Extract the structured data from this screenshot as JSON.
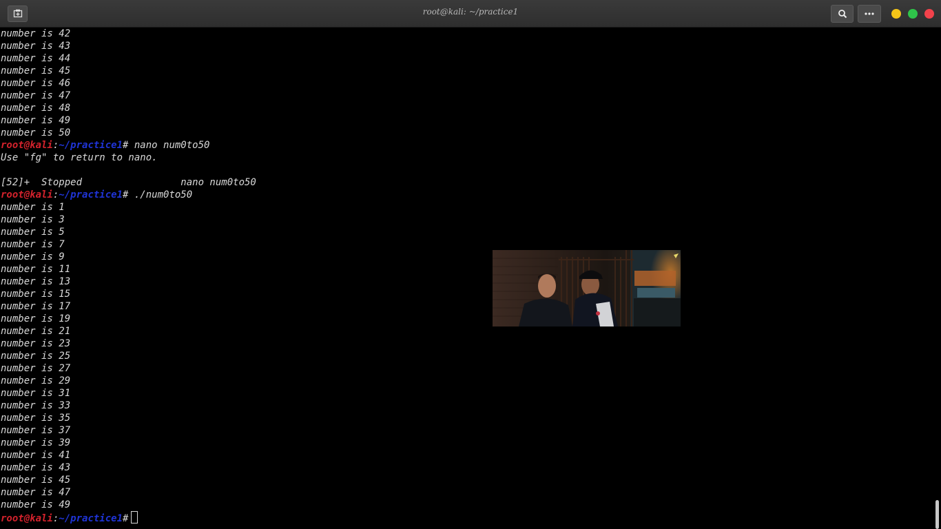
{
  "window": {
    "title": "root@kali: ~/practice1",
    "new_tab_icon": "new-tab-icon",
    "search_icon": "search-icon",
    "menu_icon": "ellipsis-icon",
    "controls": {
      "minimize": "#f5c518",
      "maximize": "#2fc44a",
      "close": "#f2424b"
    }
  },
  "terminal": {
    "prompt": {
      "user_host": "root@kali",
      "separator": ":",
      "path": "~/practice1",
      "symbol": "#"
    },
    "lines": [
      "number is 42",
      "number is 43",
      "number is 44",
      "number is 45",
      "number is 46",
      "number is 47",
      "number is 48",
      "number is 49",
      "number is 50",
      {
        "command": " nano num0to50"
      },
      "Use \"fg\" to return to nano.",
      "",
      "[52]+  Stopped                 nano num0to50",
      {
        "command": " ./num0to50"
      },
      "number is 1",
      "number is 3",
      "number is 5",
      "number is 7",
      "number is 9",
      "number is 11",
      "number is 13",
      "number is 15",
      "number is 17",
      "number is 19",
      "number is 21",
      "number is 23",
      "number is 25",
      "number is 27",
      "number is 29",
      "number is 31",
      "number is 33",
      "number is 35",
      "number is 37",
      "number is 39",
      "number is 41",
      "number is 43",
      "number is 45",
      "number is 47",
      "number is 49",
      {
        "command": " ",
        "active": true
      }
    ]
  },
  "overlay": {
    "type": "picture-in-picture video"
  }
}
